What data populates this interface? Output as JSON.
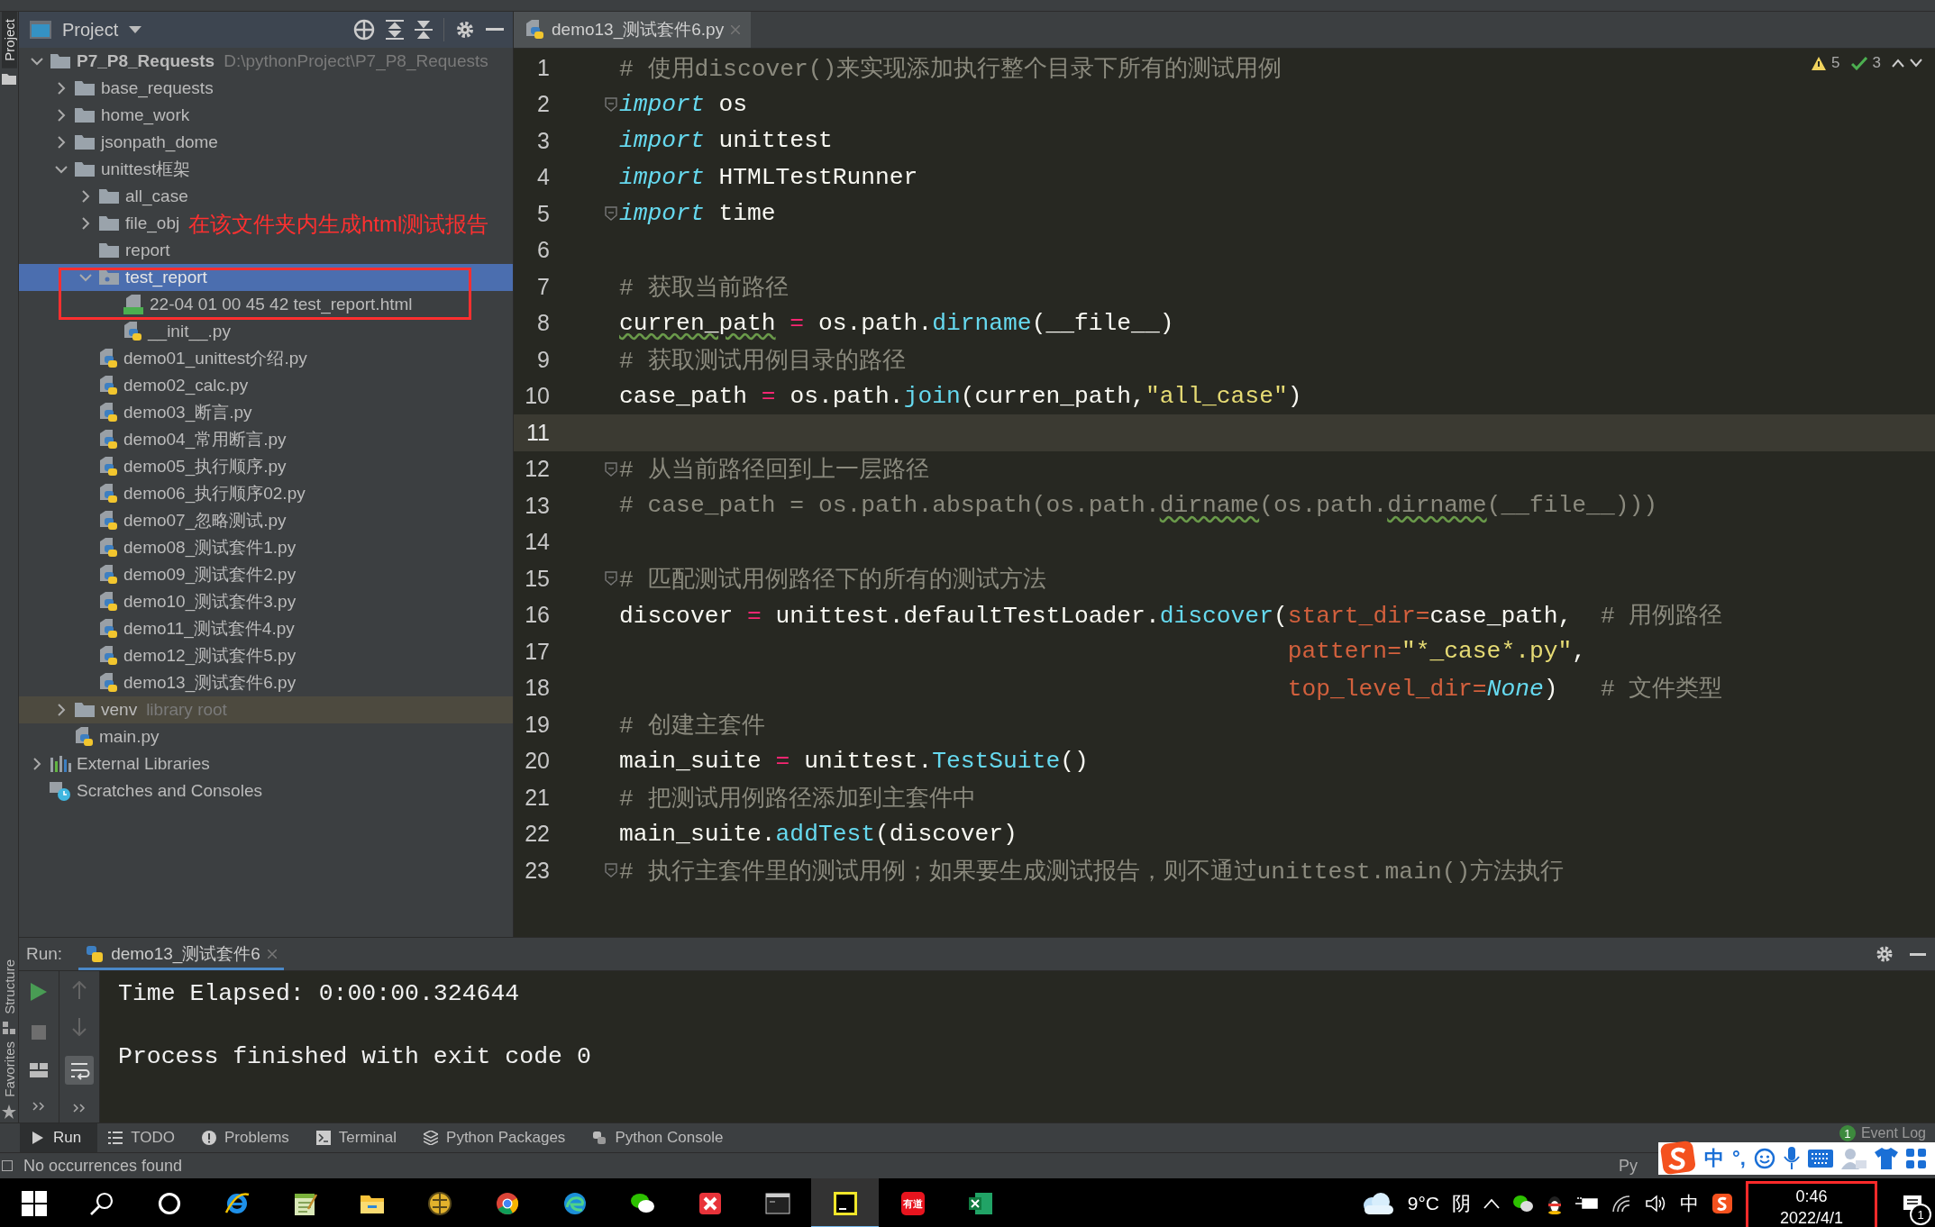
{
  "side_strip": {
    "top": "Project",
    "structure": "Structure",
    "favorites": "Favorites"
  },
  "project_panel": {
    "title": "Project",
    "tree": [
      {
        "label": "P7_P8_Requests",
        "hint": "D:\\pythonProject\\P7_P8_Requests",
        "kind": "project",
        "expanded": true,
        "selected": false,
        "children": [
          {
            "label": "base_requests",
            "kind": "folder",
            "expanded": false,
            "selected": false
          },
          {
            "label": "home_work",
            "kind": "folder",
            "expanded": false,
            "selected": false
          },
          {
            "label": "jsonpath_dome",
            "kind": "folder",
            "expanded": false,
            "selected": false
          },
          {
            "label": "unittest框架",
            "kind": "folder",
            "expanded": true,
            "selected": false,
            "children": [
              {
                "label": "all_case",
                "kind": "folder",
                "expanded": false,
                "selected": false
              },
              {
                "label": "file_obj",
                "kind": "folder",
                "expanded": false,
                "selected": false
              },
              {
                "label": "report",
                "kind": "leaf-folder",
                "selected": false
              },
              {
                "label": "test_report",
                "kind": "package",
                "expanded": true,
                "selected": true,
                "children": [
                  {
                    "label": "22-04 01 00 45 42 test_report.html",
                    "kind": "html",
                    "selected": false
                  },
                  {
                    "label": "__init__.py",
                    "kind": "python",
                    "selected": false
                  }
                ]
              },
              {
                "label": "demo01_unittest介绍.py",
                "kind": "python",
                "selected": false
              },
              {
                "label": "demo02_calc.py",
                "kind": "python",
                "selected": false
              },
              {
                "label": "demo03_断言.py",
                "kind": "python",
                "selected": false
              },
              {
                "label": "demo04_常用断言.py",
                "kind": "python",
                "selected": false
              },
              {
                "label": "demo05_执行顺序.py",
                "kind": "python",
                "selected": false
              },
              {
                "label": "demo06_执行顺序02.py",
                "kind": "python",
                "selected": false
              },
              {
                "label": "demo07_忽略测试.py",
                "kind": "python",
                "selected": false
              },
              {
                "label": "demo08_测试套件1.py",
                "kind": "python",
                "selected": false
              },
              {
                "label": "demo09_测试套件2.py",
                "kind": "python",
                "selected": false
              },
              {
                "label": "demo10_测试套件3.py",
                "kind": "python",
                "selected": false
              },
              {
                "label": "demo11_测试套件4.py",
                "kind": "python",
                "selected": false
              },
              {
                "label": "demo12_测试套件5.py",
                "kind": "python",
                "selected": false
              },
              {
                "label": "demo13_测试套件6.py",
                "kind": "python",
                "selected": false
              }
            ]
          },
          {
            "label": "venv",
            "hint": "library root",
            "kind": "library",
            "expanded": false,
            "selected": false
          },
          {
            "label": "main.py",
            "kind": "python",
            "selected": false
          }
        ]
      },
      {
        "label": "External Libraries",
        "kind": "libraries",
        "expanded": false,
        "selected": false
      },
      {
        "label": "Scratches and Consoles",
        "kind": "scratches",
        "selected": false
      }
    ]
  },
  "annotation": {
    "text": "在该文件夹内生成html测试报告"
  },
  "editor": {
    "tab": {
      "label": "demo13_测试套件6.py",
      "selected": true
    },
    "warnings": "5",
    "checks": "3",
    "lines": [
      {
        "number": "1",
        "fold": false,
        "current": false,
        "tokens": [
          {
            "text": "# 使用discover()来实现添加执行整个目录下所有的测试用例",
            "kind": "comment"
          }
        ]
      },
      {
        "number": "2",
        "fold": true,
        "current": false,
        "tokens": [
          {
            "text": "import",
            "kind": "keyword"
          },
          {
            "text": " os",
            "kind": "plain"
          }
        ]
      },
      {
        "number": "3",
        "fold": false,
        "current": false,
        "tokens": [
          {
            "text": "import",
            "kind": "keyword"
          },
          {
            "text": " unittest",
            "kind": "plain"
          }
        ]
      },
      {
        "number": "4",
        "fold": false,
        "current": false,
        "tokens": [
          {
            "text": "import",
            "kind": "keyword"
          },
          {
            "text": " HTMLTestRunner",
            "kind": "plain"
          }
        ]
      },
      {
        "number": "5",
        "fold": true,
        "current": false,
        "tokens": [
          {
            "text": "import",
            "kind": "keyword"
          },
          {
            "text": " time",
            "kind": "plain"
          }
        ]
      },
      {
        "number": "6",
        "fold": false,
        "current": false
      },
      {
        "number": "7",
        "fold": false,
        "current": false,
        "tokens": [
          {
            "text": "# 获取当前路径",
            "kind": "comment"
          }
        ]
      },
      {
        "number": "8",
        "fold": false,
        "current": false,
        "tokens": [
          {
            "text": "curren_path",
            "kind": "typo"
          },
          {
            "text": " = ",
            "kind": "operator"
          },
          {
            "text": "os.path.",
            "kind": "plain"
          },
          {
            "text": "dirname",
            "kind": "function"
          },
          {
            "text": "(__file__)",
            "kind": "plain"
          }
        ]
      },
      {
        "number": "9",
        "fold": false,
        "current": false,
        "tokens": [
          {
            "text": "# 获取测试用例目录的路径",
            "kind": "comment"
          }
        ]
      },
      {
        "number": "10",
        "fold": false,
        "current": false,
        "tokens": [
          {
            "text": "case_path",
            "kind": "plain"
          },
          {
            "text": " = ",
            "kind": "operator"
          },
          {
            "text": "os.path.",
            "kind": "plain"
          },
          {
            "text": "join",
            "kind": "function"
          },
          {
            "text": "(curren_path,",
            "kind": "plain"
          },
          {
            "text": "\"all_case\"",
            "kind": "string"
          },
          {
            "text": ")",
            "kind": "plain"
          }
        ]
      },
      {
        "number": "11",
        "fold": false,
        "current": true
      },
      {
        "number": "12",
        "fold": true,
        "current": false,
        "tokens": [
          {
            "text": "# 从当前路径回到上一层路径",
            "kind": "comment"
          }
        ]
      },
      {
        "number": "13",
        "fold": false,
        "current": false,
        "tokens": [
          {
            "text": "# case_path = os.path.abspath(os.path.",
            "kind": "comment"
          },
          {
            "text": "dirname",
            "kind": "comment-typo"
          },
          {
            "text": "(os.path.",
            "kind": "comment"
          },
          {
            "text": "dirname",
            "kind": "comment-typo"
          },
          {
            "text": "(__file__)))",
            "kind": "comment"
          }
        ]
      },
      {
        "number": "14",
        "fold": false,
        "current": false
      },
      {
        "number": "15",
        "fold": true,
        "current": false,
        "tokens": [
          {
            "text": "# 匹配测试用例路径下的所有的测试方法",
            "kind": "comment"
          }
        ]
      },
      {
        "number": "16",
        "fold": false,
        "current": false,
        "tokens": [
          {
            "text": "discover",
            "kind": "plain"
          },
          {
            "text": " = ",
            "kind": "operator"
          },
          {
            "text": "unittest.defaultTestLoader.",
            "kind": "plain"
          },
          {
            "text": "discover",
            "kind": "function"
          },
          {
            "text": "(",
            "kind": "plain"
          },
          {
            "text": "start_dir",
            "kind": "parameter"
          },
          {
            "text": "=",
            "kind": "parameter"
          },
          {
            "text": "case_path,  ",
            "kind": "plain"
          },
          {
            "text": "# 用例路径",
            "kind": "comment"
          }
        ]
      },
      {
        "number": "17",
        "fold": false,
        "current": false,
        "continuation": true,
        "tokens": [
          {
            "text": "pattern=",
            "kind": "parameter"
          },
          {
            "text": "\"*_case*.py\"",
            "kind": "string"
          },
          {
            "text": ",",
            "kind": "plain"
          }
        ]
      },
      {
        "number": "18",
        "fold": false,
        "current": false,
        "continuation": true,
        "tokens": [
          {
            "text": "top_level_dir=",
            "kind": "parameter"
          },
          {
            "text": "None",
            "kind": "constant"
          },
          {
            "text": ")   ",
            "kind": "plain"
          },
          {
            "text": "# 文件类型",
            "kind": "comment"
          }
        ]
      },
      {
        "number": "19",
        "fold": false,
        "current": false,
        "tokens": [
          {
            "text": "# 创建主套件",
            "kind": "comment"
          }
        ]
      },
      {
        "number": "20",
        "fold": false,
        "current": false,
        "tokens": [
          {
            "text": "main_suite",
            "kind": "plain"
          },
          {
            "text": " = ",
            "kind": "operator"
          },
          {
            "text": "unittest.",
            "kind": "plain"
          },
          {
            "text": "TestSuite",
            "kind": "function"
          },
          {
            "text": "()",
            "kind": "plain"
          }
        ]
      },
      {
        "number": "21",
        "fold": false,
        "current": false,
        "tokens": [
          {
            "text": "# 把测试用例路径添加到主套件中",
            "kind": "comment"
          }
        ]
      },
      {
        "number": "22",
        "fold": false,
        "current": false,
        "tokens": [
          {
            "text": "main_suite.",
            "kind": "plain"
          },
          {
            "text": "addTest",
            "kind": "function"
          },
          {
            "text": "(discover)",
            "kind": "plain"
          }
        ]
      },
      {
        "number": "23",
        "fold": true,
        "current": false,
        "tokens": [
          {
            "text": "# 执行主套件里的测试用例；如果要生成测试报告，则不通过unittest.main()方法执行",
            "kind": "comment"
          }
        ]
      }
    ]
  },
  "run_panel": {
    "label": "Run:",
    "tab": {
      "label": "demo13_测试套件6",
      "selected": true
    },
    "output": [
      "Time Elapsed: 0:00:00.324644",
      "Process finished with exit code 0"
    ]
  },
  "tool_windows": [
    {
      "label": "Run",
      "kind": "run",
      "selected": true
    },
    {
      "label": "TODO",
      "kind": "todo",
      "selected": false
    },
    {
      "label": "Problems",
      "kind": "problems",
      "selected": false
    },
    {
      "label": "Terminal",
      "kind": "terminal",
      "selected": false
    },
    {
      "label": "Python Packages",
      "kind": "packages",
      "selected": false
    },
    {
      "label": "Python Console",
      "kind": "console",
      "selected": false
    }
  ],
  "event_log": {
    "badge": "1",
    "label": "Event Log"
  },
  "status_bar": {
    "message": "No occurrences found",
    "interpreter": "Py"
  },
  "ime_bar": {
    "mode": "中",
    "punctuation": "°,"
  },
  "taskbar": {
    "apps": [
      {
        "kind": "start",
        "selected": false
      },
      {
        "kind": "search",
        "selected": false
      },
      {
        "kind": "cortana",
        "selected": false
      },
      {
        "kind": "ie",
        "selected": false
      },
      {
        "kind": "notepad",
        "selected": false
      },
      {
        "kind": "explorer",
        "selected": false
      },
      {
        "kind": "ue",
        "selected": false
      },
      {
        "kind": "chrome",
        "selected": false
      },
      {
        "kind": "edge",
        "selected": false
      },
      {
        "kind": "wechat",
        "selected": false
      },
      {
        "kind": "xmind",
        "selected": false
      },
      {
        "kind": "cmd",
        "selected": false
      },
      {
        "kind": "pycharm",
        "selected": true
      },
      {
        "kind": "youdao",
        "label": "有道",
        "selected": false
      },
      {
        "kind": "excel",
        "selected": false
      }
    ],
    "weather": "9°C",
    "condition": "阴",
    "language": "中",
    "time": "0:46",
    "date": "2022/4/1",
    "notifications": "1"
  }
}
